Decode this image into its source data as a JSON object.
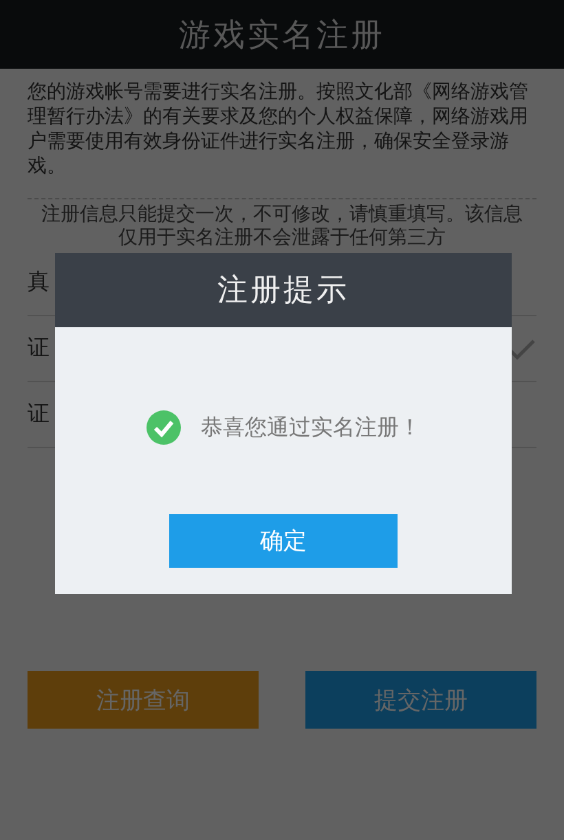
{
  "header": {
    "title": "游戏实名注册"
  },
  "intro": "您的游戏帐号需要进行实名注册。按照文化部《网络游戏管理暂行办法》的有关要求及您的个人权益保障，网络游戏用户需要使用有效身份证件进行实名注册，确保安全登录游戏。",
  "notice": [
    "注册信息只能提交一次，不可修改，请慎重填写。该信息",
    "仅用于实名注册不会泄露于任何第三方"
  ],
  "form_rows": [
    {
      "label": "真",
      "valid": false
    },
    {
      "label": "证",
      "valid": true
    },
    {
      "label": "证",
      "valid": false
    }
  ],
  "buttons": [
    {
      "label": "注册查询",
      "kind": "query"
    },
    {
      "label": "提交注册",
      "kind": "submit"
    }
  ],
  "dialog": {
    "title": "注册提示",
    "message": "恭喜您通过实名注册！",
    "success": true,
    "button": "确定"
  }
}
